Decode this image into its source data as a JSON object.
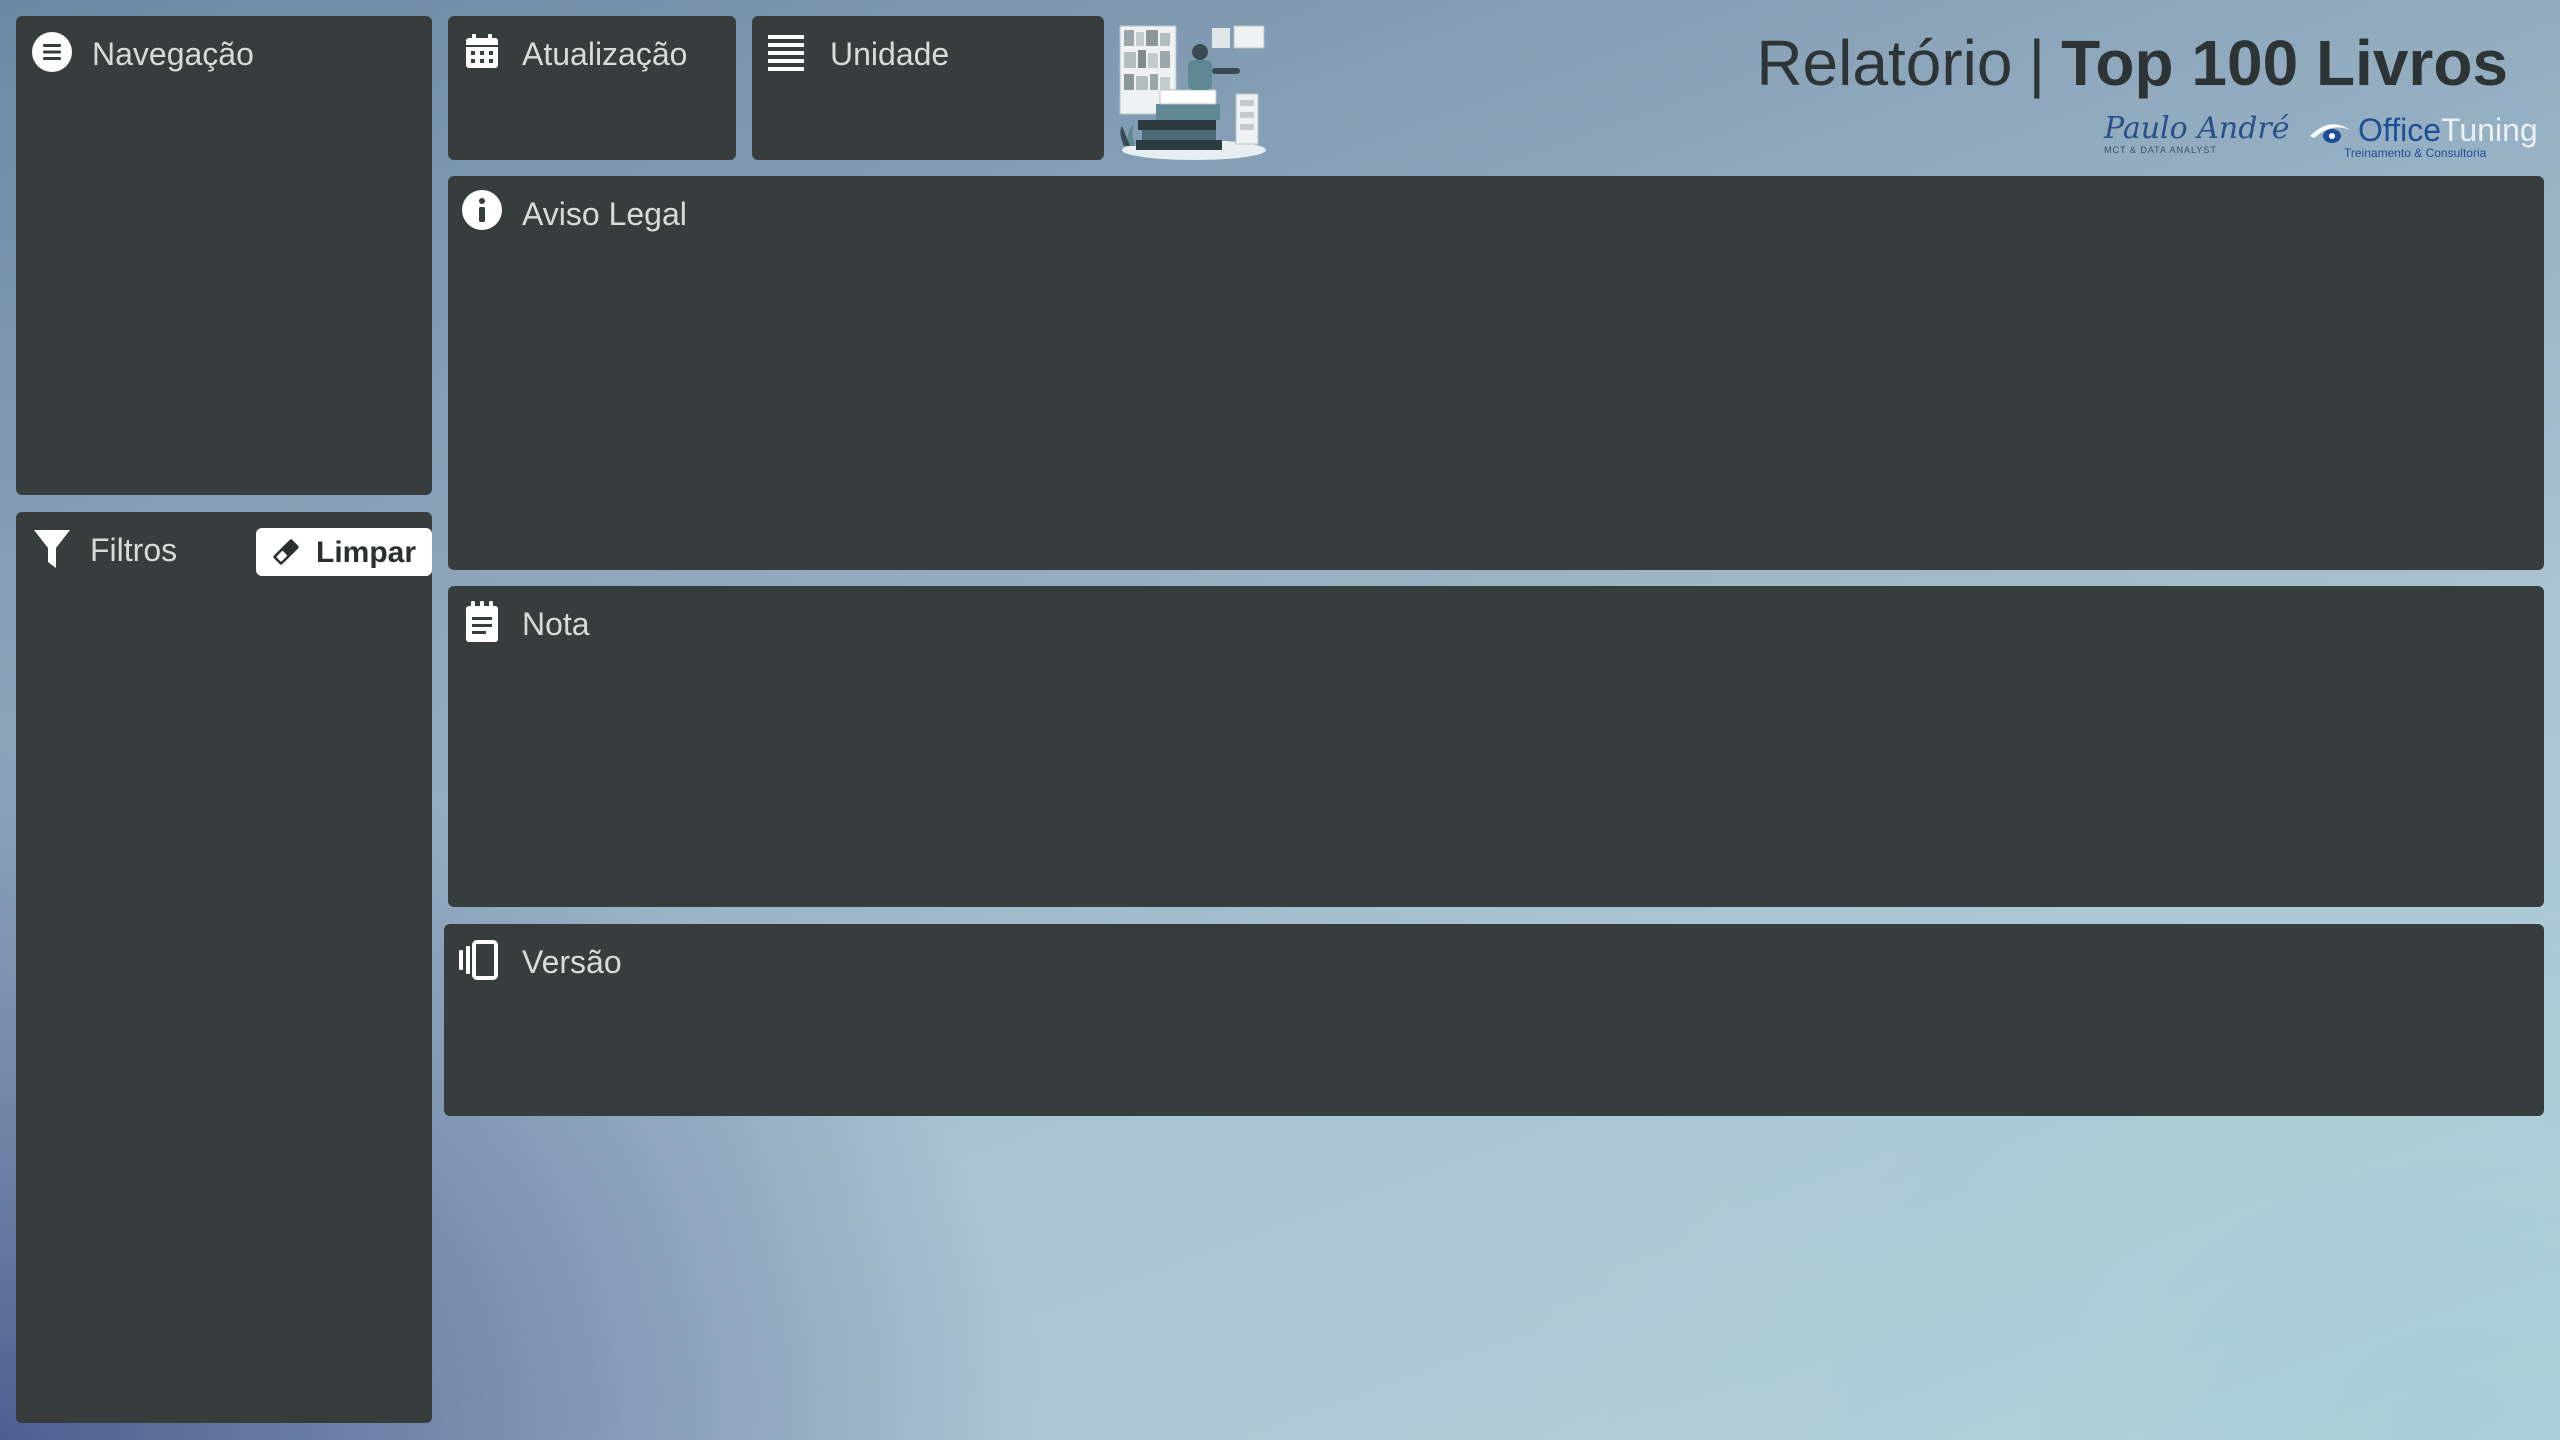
{
  "header": {
    "title_light": "Relatório",
    "title_separator": "|",
    "title_bold": "Top 100 Livros",
    "logo_paulo": {
      "name": "Paulo André",
      "subtitle": "MCT & DATA ANALYST"
    },
    "logo_office": {
      "brand_part1": "Office",
      "brand_part2": "Tuning",
      "tagline": "Treinamento & Consultoria"
    }
  },
  "panels": {
    "navigation": {
      "title": "Navegação",
      "icon": "menu-icon"
    },
    "filters": {
      "title": "Filtros",
      "icon": "filter-icon",
      "clear_label": "Limpar",
      "clear_icon": "eraser-icon"
    },
    "update": {
      "title": "Atualização",
      "icon": "calendar-icon"
    },
    "unit": {
      "title": "Unidade",
      "icon": "list-icon"
    },
    "legal": {
      "title": "Aviso Legal",
      "icon": "info-icon"
    },
    "note": {
      "title": "Nota",
      "icon": "notepad-icon"
    },
    "version": {
      "title": "Versão",
      "icon": "versions-icon"
    }
  },
  "colors": {
    "panel_bg": "#373d3c",
    "panel_text": "#d9dbd9",
    "title_text": "#2c3436",
    "logo_blue": "#1e4f96"
  }
}
